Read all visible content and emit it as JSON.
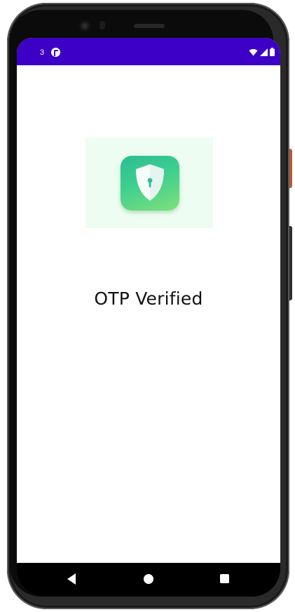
{
  "status_bar": {
    "time": "3",
    "app_icon": "cast-icon",
    "wifi_icon": "wifi-icon",
    "signal_icon": "cellular-signal-icon",
    "battery_icon": "battery-icon",
    "background_color": "#3d00c6"
  },
  "main": {
    "logo_icon": "shield-lock-icon",
    "logo_tile_color": "#eefdf1",
    "title": "OTP Verified"
  },
  "nav_bar": {
    "back_icon": "back-triangle-icon",
    "home_icon": "home-circle-icon",
    "recents_icon": "recents-square-icon"
  }
}
